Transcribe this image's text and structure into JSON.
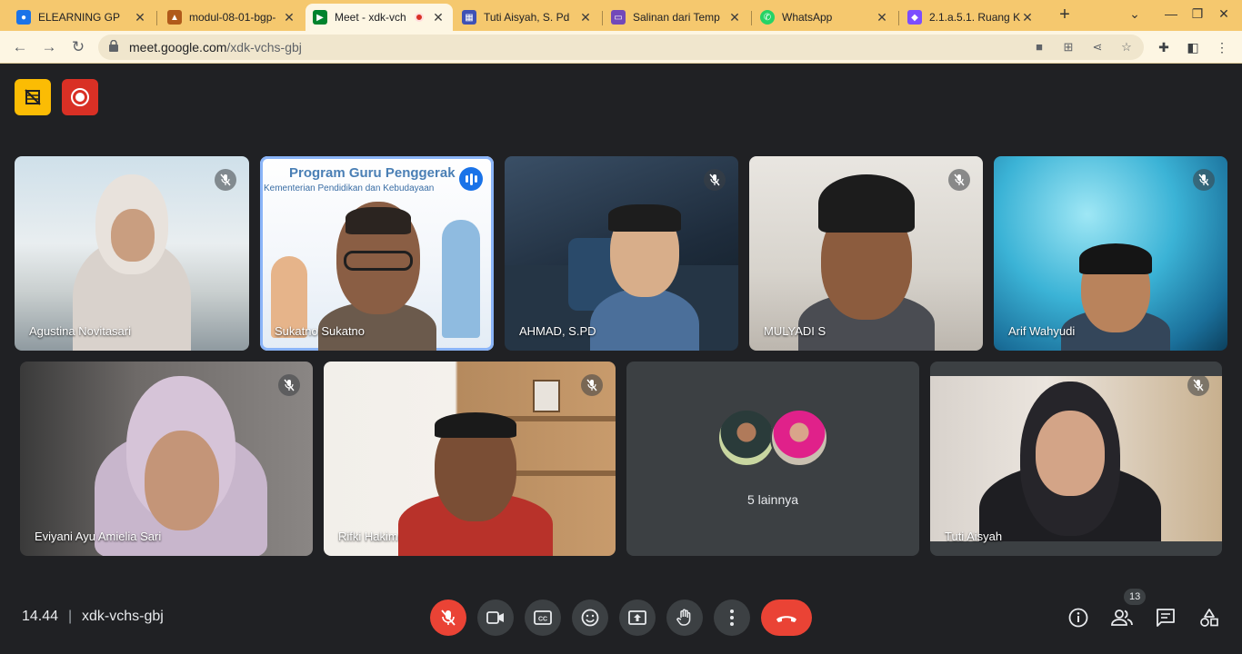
{
  "browser": {
    "tabs": [
      {
        "title": "ELEARNING GP",
        "fav_color": "#1a73e8"
      },
      {
        "title": "modul-08-01-bgp-",
        "fav_color": "#b05a1a"
      },
      {
        "title": "Meet - xdk-vch",
        "fav_color": "#00832d",
        "recording": true
      },
      {
        "title": "Tuti Aisyah, S. Pd",
        "fav_color": "#3f51b5"
      },
      {
        "title": "Salinan dari Temp",
        "fav_color": "#7248b9"
      },
      {
        "title": "WhatsApp",
        "fav_color": "#25d366"
      },
      {
        "title": "2.1.a.5.1. Ruang K",
        "fav_color": "#7c4dff"
      }
    ],
    "url_host": "meet.google.com",
    "url_path": "/xdk-vchs-gbj"
  },
  "participants": [
    {
      "name": "Agustina Novitasari",
      "muted": true
    },
    {
      "name": "Sukatno Sukatno",
      "speaking": true,
      "bg_line1": "Program Guru Penggerak",
      "bg_line2": "Kementerian Pendidikan dan Kebudayaan"
    },
    {
      "name": "AHMAD, S.PD",
      "muted": true
    },
    {
      "name": "MULYADI S",
      "muted": true
    },
    {
      "name": "Arif Wahyudi",
      "muted": true
    },
    {
      "name": "Eviyani Ayu Amielia Sari",
      "muted": true
    },
    {
      "name": "Rifki Hakim",
      "muted": true
    },
    {
      "name": "Tuti Aisyah",
      "muted": true
    }
  ],
  "others": {
    "label": "5 lainnya"
  },
  "meeting": {
    "time": "14.44",
    "separator": "|",
    "code": "xdk-vchs-gbj",
    "participant_count": "13"
  }
}
